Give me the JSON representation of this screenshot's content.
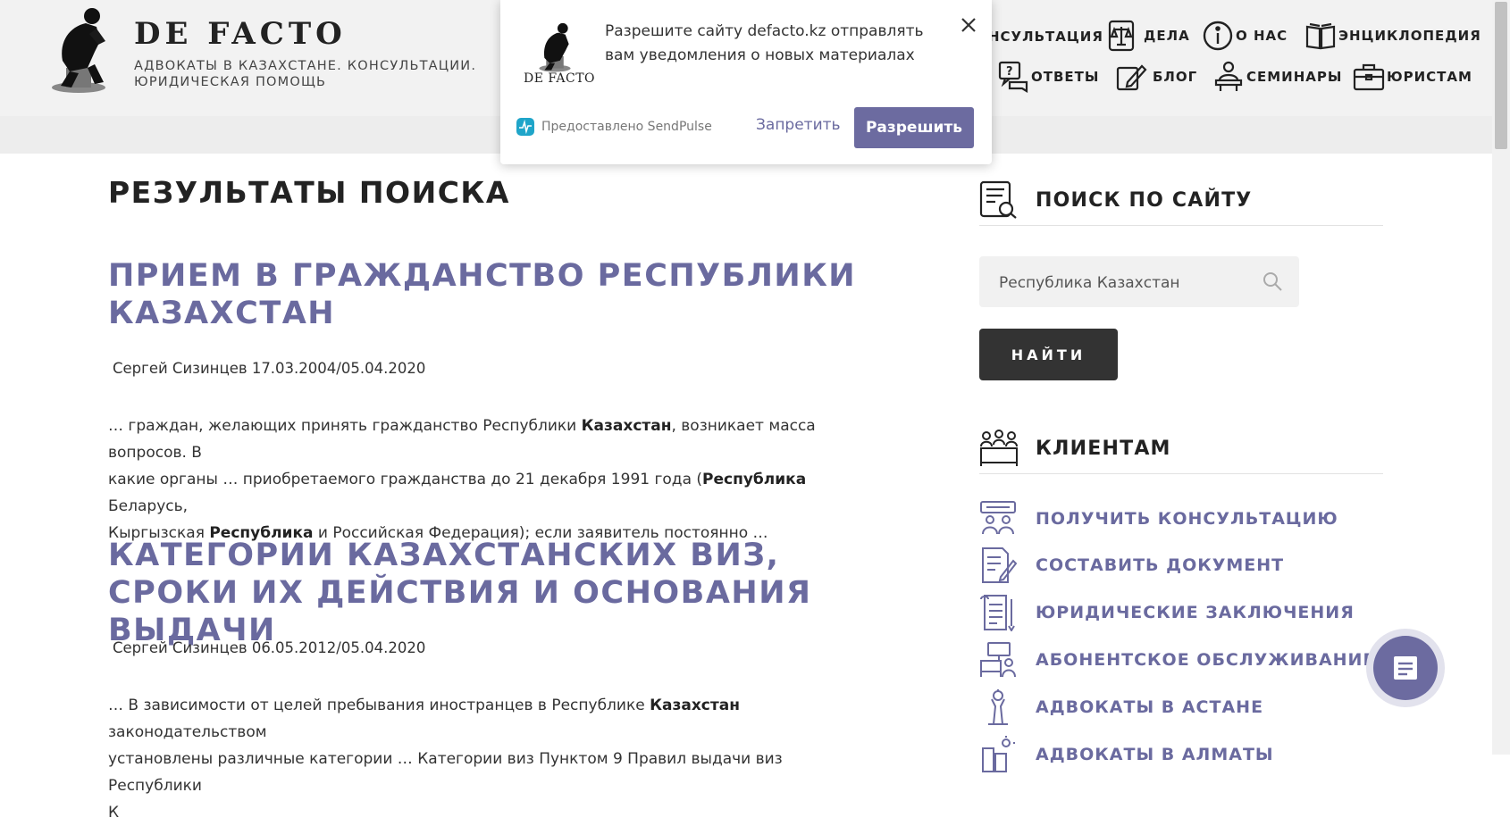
{
  "header": {
    "brand": "DE FACTO",
    "tagline_line1": "АДВОКАТЫ В КАЗАХСТАНЕ. КОНСУЛЬТАЦИИ.",
    "tagline_line2": "ЮРИДИЧЕСКАЯ ПОМОЩЬ",
    "nav": [
      {
        "label": "НСУЛЬТАЦИЯ",
        "icon": "consultation-icon"
      },
      {
        "label": "ДЕЛА",
        "icon": "scales-icon"
      },
      {
        "label": "О НАС",
        "icon": "info-icon"
      },
      {
        "label": "ЭНЦИКЛОПЕДИЯ",
        "icon": "book-icon"
      },
      {
        "label": "ОТВЕТЫ",
        "icon": "question-chat-icon"
      },
      {
        "label": "БЛОГ",
        "icon": "pencil-note-icon"
      },
      {
        "label": "СЕМИНАРЫ",
        "icon": "lecturer-icon"
      },
      {
        "label": "ЮРИСТАМ",
        "icon": "briefcase-icon"
      }
    ]
  },
  "popup": {
    "logo_text": "DE FACTO",
    "message": "Разрешите сайту defacto.kz отправлять вам уведомления о новых материалах",
    "provider": "Предоставлено SendPulse",
    "deny_label": "Запретить",
    "allow_label": "Разрешить"
  },
  "main": {
    "page_title": "РЕЗУЛЬТАТЫ ПОИСКА",
    "results": [
      {
        "title": "ПРИЕМ В ГРАЖДАНСТВО РЕСПУБЛИКИ КАЗАХСТАН",
        "meta": "Сергей Сизинцев 17.03.2004/05.04.2020",
        "snippet_line1": "… граждан, желающих принять гражданство Республики ",
        "snippet_bold1": "Казахстан",
        "snippet_line1b": ", возникает масса вопросов. В",
        "snippet_line2a": "какие органы … приобретаемого гражданства до 21 декабря 1991 года (",
        "snippet_bold2": "Республика",
        "snippet_line2b": " Беларусь,",
        "snippet_line3a": "Кыргызская ",
        "snippet_bold3": "Республика",
        "snippet_line3b": " и Российская Федерация); если заявитель постоянно …"
      },
      {
        "title": "КАТЕГОРИИ КАЗАХСТАНСКИХ ВИЗ, СРОКИ ИХ ДЕЙСТВИЯ И ОСНОВАНИЯ ВЫДАЧИ",
        "meta": "Сергей Сизинцев 06.05.2012/05.04.2020",
        "snippet_line1": "… В зависимости от целей пребывания иностранцев в Республике ",
        "snippet_bold1": "Казахстан",
        "snippet_line1b": " законодательством",
        "snippet_line2a": "установлены различные категории … Категории виз Пунктом 9 Правил выдачи виз Республики",
        "snippet_line3a": "К"
      }
    ]
  },
  "sidebar": {
    "search_title": "ПОИСК ПО САЙТУ",
    "search_value": "Республика Казахстан",
    "search_button": "НАЙТИ",
    "clients_title": "КЛИЕНТАМ",
    "client_links": [
      {
        "label": "ПОЛУЧИТЬ КОНСУЛЬТАЦИЮ",
        "icon": "consult-people-icon"
      },
      {
        "label": "СОСТАВИТЬ ДОКУМЕНТ",
        "icon": "document-pen-icon"
      },
      {
        "label": "ЮРИДИЧЕСКИЕ ЗАКЛЮЧЕНИЯ",
        "icon": "checklist-icon"
      },
      {
        "label": "АБОНЕНТСКОЕ ОБСЛУЖИВАНИЕ",
        "icon": "workstation-icon"
      },
      {
        "label": "АДВОКАТЫ В АСТАНЕ",
        "icon": "tower-icon"
      },
      {
        "label": "АДВОКАТЫ В АЛМАТЫ",
        "icon": "city-icon"
      }
    ]
  },
  "colors": {
    "accent": "#6a6a9f",
    "header_bg": "#f2f2f2",
    "button_dark": "#333333"
  }
}
